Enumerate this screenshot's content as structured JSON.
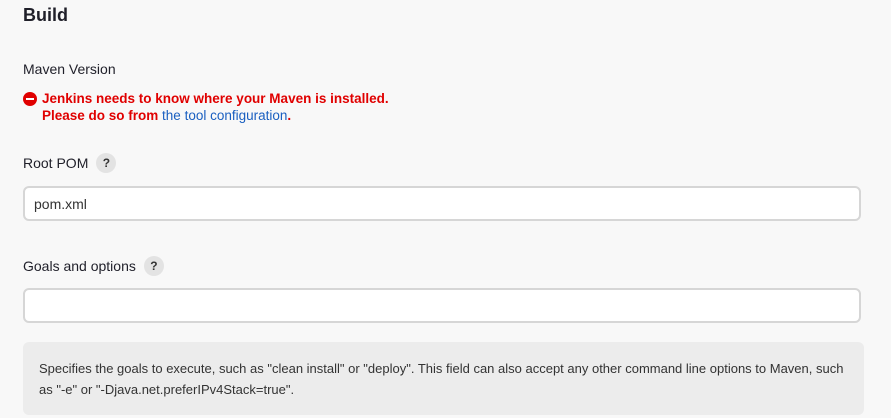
{
  "section": {
    "title": "Build"
  },
  "maven_version": {
    "label": "Maven Version",
    "error_line1": "Jenkins needs to know where your Maven is installed.",
    "error_line2_prefix": "Please do so from ",
    "error_link": "the tool configuration",
    "error_line2_suffix": "."
  },
  "root_pom": {
    "label": "Root POM",
    "help_icon": "?",
    "value": "pom.xml"
  },
  "goals": {
    "label": "Goals and options",
    "help_icon": "?",
    "value": "",
    "help_text": "Specifies the goals to execute, such as \"clean install\" or \"deploy\". This field can also accept any other command line options to Maven, such as \"-e\" or \"-Djava.net.preferIPv4Stack=true\"."
  },
  "colors": {
    "error": "#e00000",
    "link": "#1a5fc0"
  }
}
